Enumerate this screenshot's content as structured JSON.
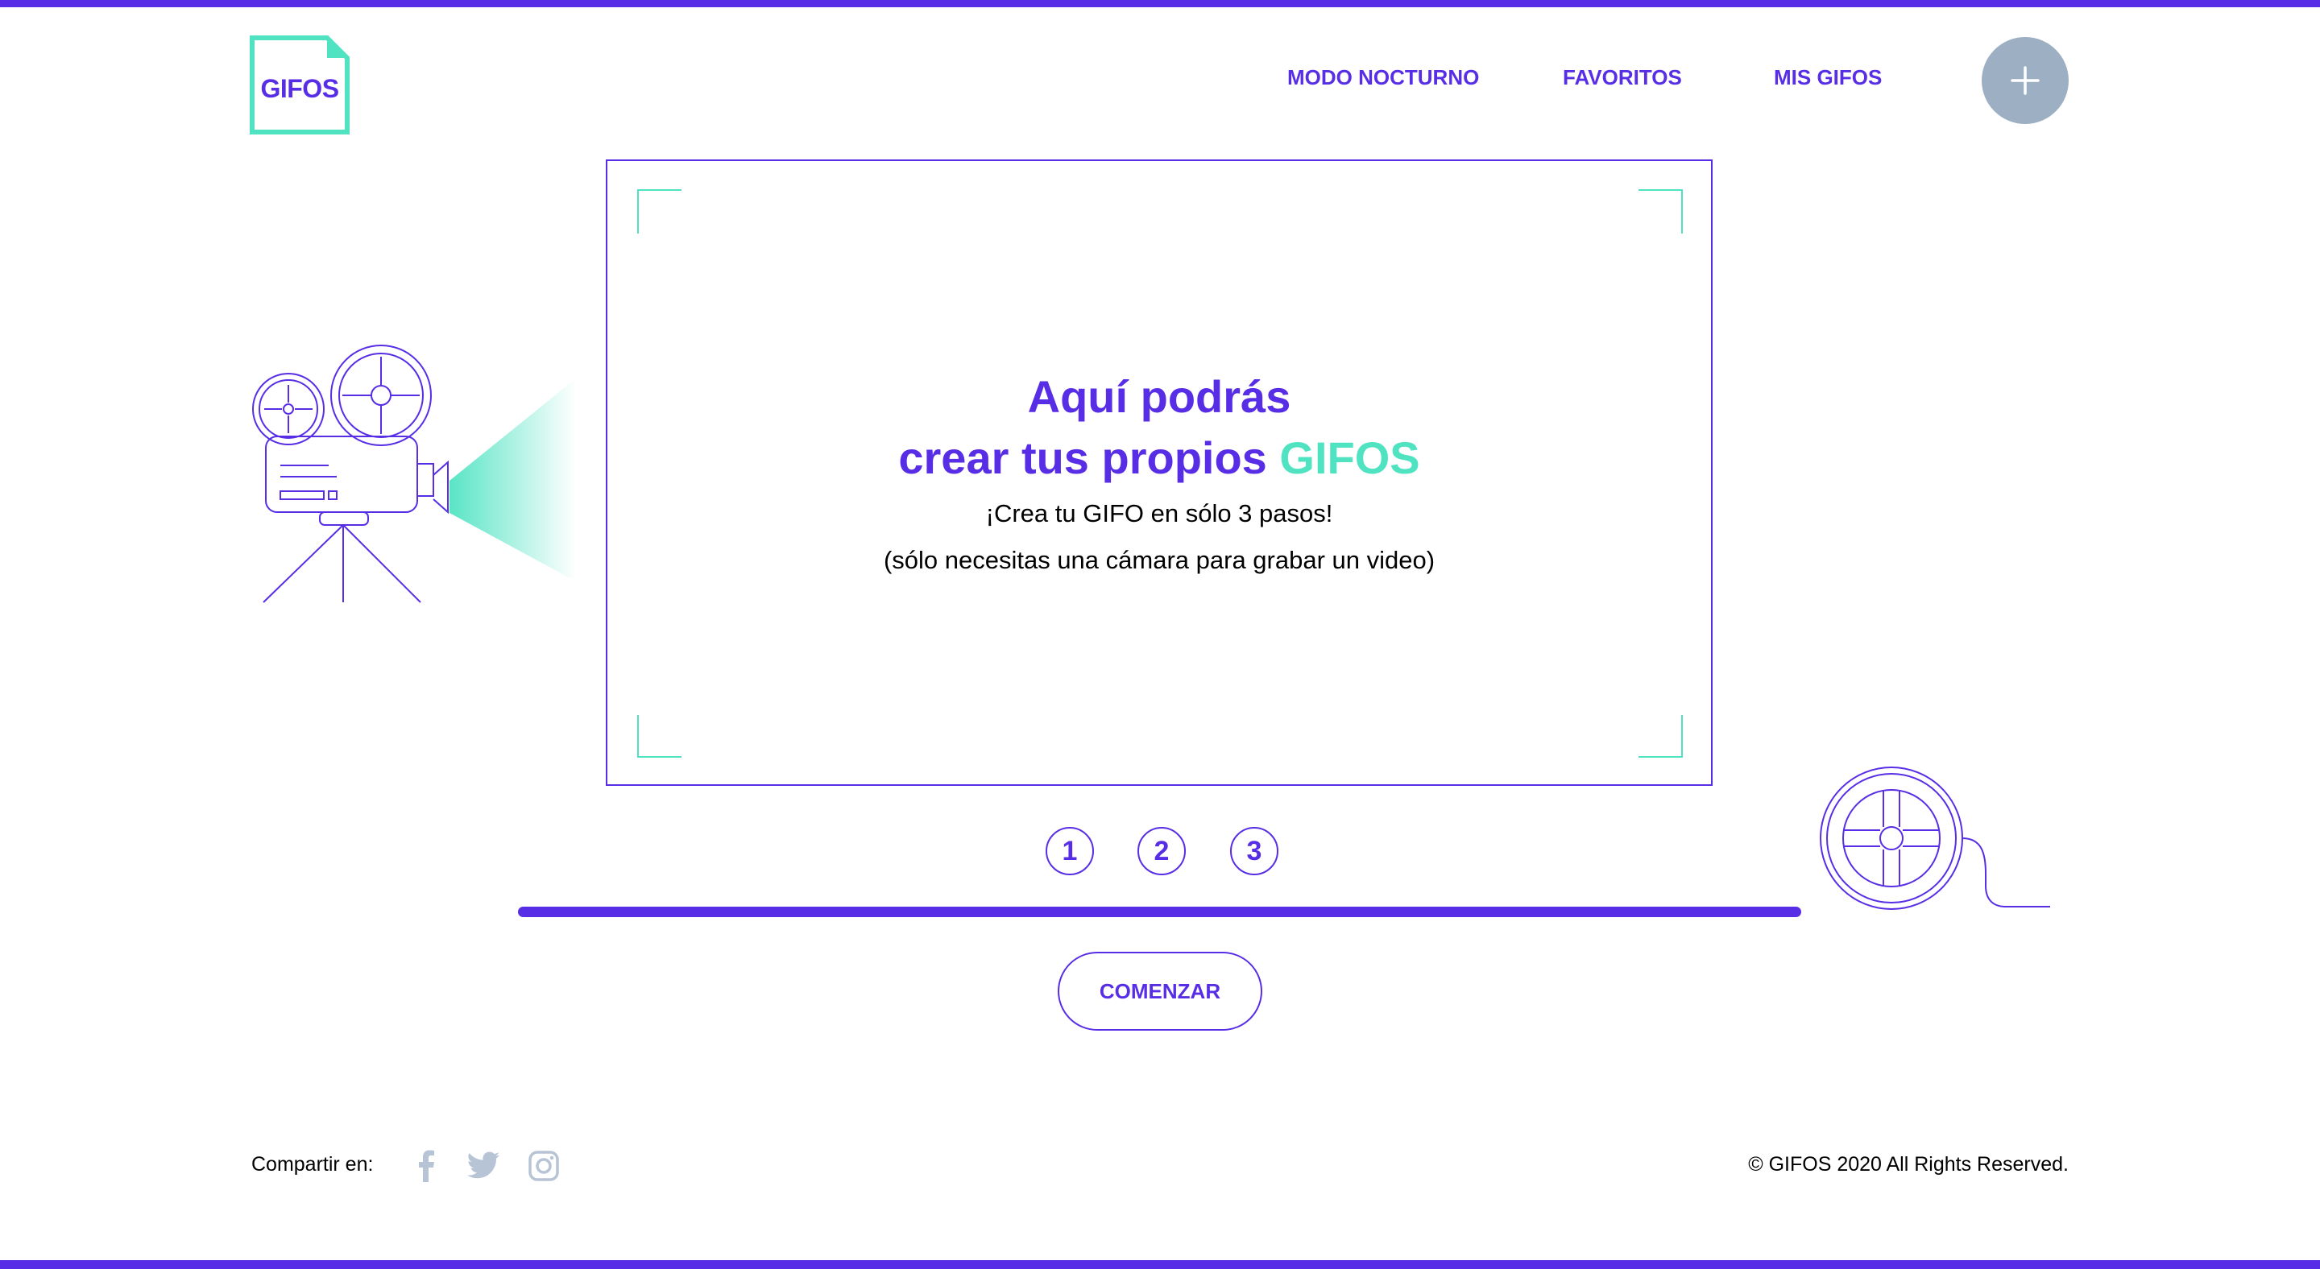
{
  "header": {
    "logo_text": "GIFOS",
    "nav": {
      "night_mode": "MODO NOCTURNO",
      "favorites": "FAVORITOS",
      "my_gifs": "MIS GIFOS"
    },
    "add_button_symbol": "+"
  },
  "main": {
    "title_line1": "Aquí podrás",
    "title_line2_prefix": "crear tus propios",
    "title_line2_accent": "GIFOS",
    "subtitle_line1": "¡Crea tu GIFO en sólo 3 pasos!",
    "subtitle_line2": "(sólo necesitas una cámara para grabar un video)",
    "steps": [
      "1",
      "2",
      "3"
    ],
    "start_button": "COMENZAR"
  },
  "footer": {
    "share_label": "Compartir en:",
    "social_icons": [
      "facebook-icon",
      "twitter-icon",
      "instagram-icon"
    ],
    "copyright": "© GIFOS 2020 All Rights Reserved."
  },
  "colors": {
    "primary": "#572EE5",
    "accent": "#50E3C2",
    "add_button": "#9CAFC3",
    "social_icon": "#B7C4D6"
  }
}
